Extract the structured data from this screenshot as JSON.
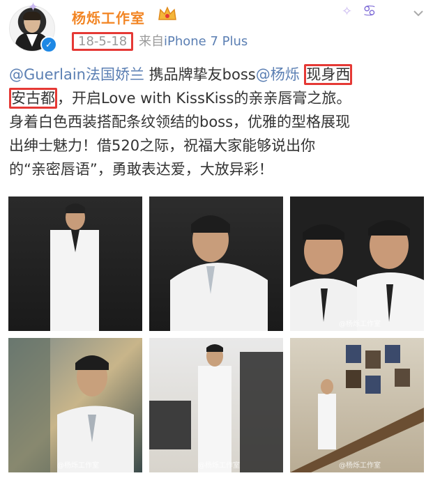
{
  "header": {
    "name": "杨烁工作室",
    "date": "18-5-18",
    "from": "来自",
    "device": "iPhone 7 Plus"
  },
  "post": {
    "mention1": "@Guerlain法国娇兰",
    "text1": " 携品牌挚友boss",
    "mention2": "@杨烁",
    "highlight1": "现身西",
    "highlight2": "安古都",
    "text2": "，开启Love with KissKiss的亲亲唇膏之旅。",
    "line3": "身着白色西装搭配条纹领结的boss，优雅的型格展现",
    "line4": "出绅士魅力！借520之际，祝福大家能够说出你",
    "line5": "的“亲密唇语”，勇敢表达爱，大放异彩！"
  },
  "photos": [
    {
      "desc": "photo-white-suit-full"
    },
    {
      "desc": "photo-white-suit-smile"
    },
    {
      "desc": "photo-double-portrait",
      "watermark": "@杨烁工作室"
    },
    {
      "desc": "photo-shelf",
      "watermark": "@杨烁工作室"
    },
    {
      "desc": "photo-store",
      "watermark": "@杨烁工作室"
    },
    {
      "desc": "photo-stairs",
      "watermark": "@杨烁工作室"
    }
  ],
  "colors": {
    "accent": "#f28524",
    "link": "#5b7fb3",
    "highlight_box": "#e53935"
  }
}
